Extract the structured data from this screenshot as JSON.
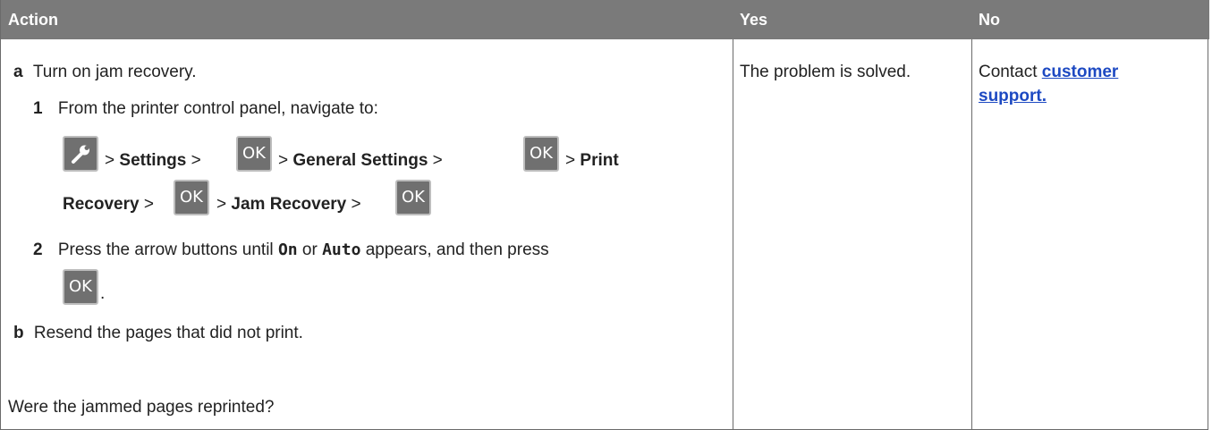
{
  "header": {
    "action": "Action",
    "yes": "Yes",
    "no": "No"
  },
  "action": {
    "a_marker": "a",
    "a_text": "Turn on jam recovery.",
    "step1_num": "1",
    "step1_text": "From the printer control panel, navigate to:",
    "path": {
      "sep": ">",
      "settings": "Settings",
      "general_settings": "General Settings",
      "print": "Print",
      "recovery": "Recovery",
      "jam_recovery": "Jam Recovery",
      "ok": "OK"
    },
    "step2_num": "2",
    "step2_pre": "Press the arrow buttons until ",
    "step2_on": "On",
    "step2_or": " or ",
    "step2_auto": "Auto",
    "step2_post": " appears, and then press",
    "step2_end": ".",
    "b_marker": "b",
    "b_text": "Resend the pages that did not print.",
    "question": "Were the jammed pages reprinted?"
  },
  "yes": {
    "text": "The problem is solved."
  },
  "no": {
    "contact": "Contact ",
    "link_line1": "customer",
    "link_line2": "support."
  },
  "icons": {
    "wrench": "wrench-icon",
    "ok": "ok-button-icon"
  },
  "colors": {
    "header_bg": "#7a7a7a",
    "link": "#1d49c2",
    "key_bg": "#707070"
  }
}
